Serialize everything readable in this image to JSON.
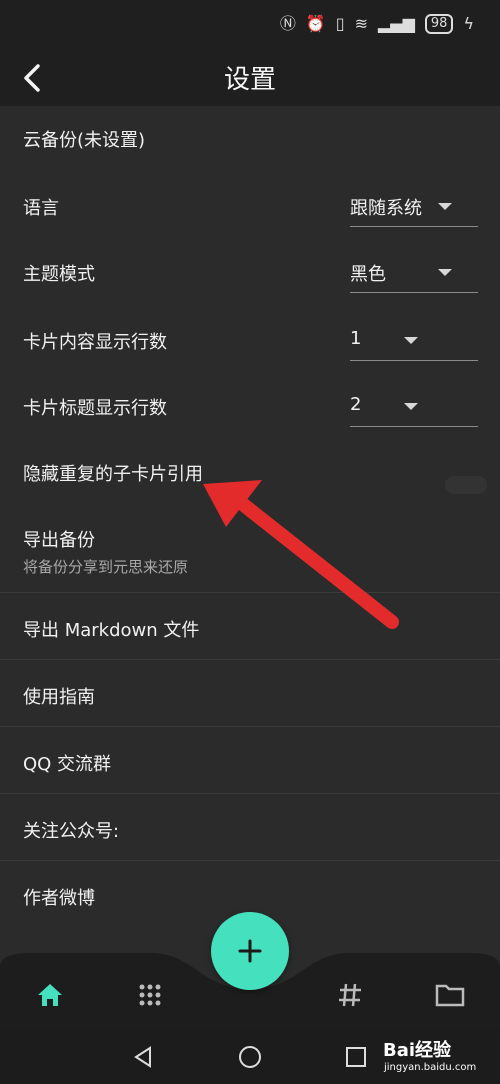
{
  "status_bar": {
    "battery": "98"
  },
  "app_bar": {
    "title": "设置"
  },
  "settings": {
    "cloud_backup": "云备份(未设置)",
    "language": {
      "label": "语言",
      "value": "跟随系统"
    },
    "theme": {
      "label": "主题模式",
      "value": "黑色"
    },
    "card_content_lines": {
      "label": "卡片内容显示行数",
      "value": "1"
    },
    "card_title_lines": {
      "label": "卡片标题显示行数",
      "value": "2"
    },
    "hide_duplicate": {
      "label": "隐藏重复的子卡片引用"
    },
    "export_backup": {
      "label": "导出备份",
      "sub": "将备份分享到元思来还原"
    },
    "export_markdown": {
      "label": "导出 Markdown 文件"
    },
    "guide": {
      "label": "使用指南"
    },
    "qq_group": {
      "label": "QQ 交流群"
    },
    "follow_account": {
      "label": "关注公众号:"
    },
    "author_weibo": {
      "label": "作者微博"
    }
  },
  "bottom_nav": {
    "items": [
      "home-icon",
      "grid-icon",
      "hashtag-icon",
      "folder-icon"
    ],
    "accent": "#45e0bd"
  },
  "watermark": {
    "brand": "Bai经验",
    "url": "jingyan.baidu.com"
  }
}
